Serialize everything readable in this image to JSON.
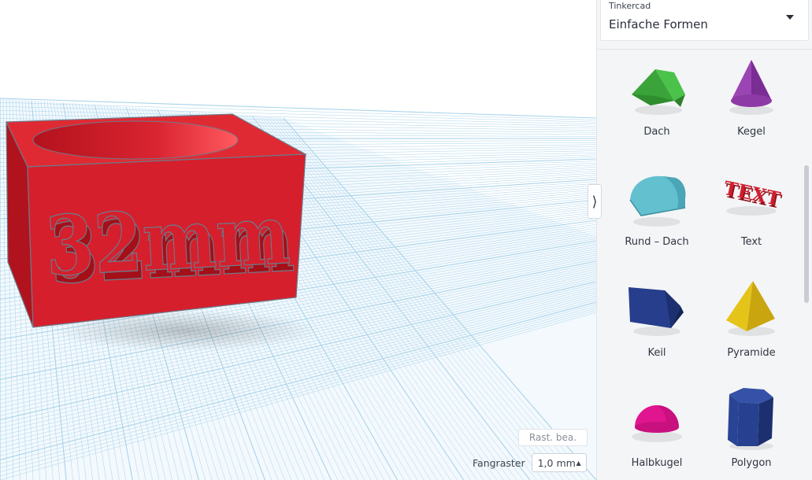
{
  "viewport": {
    "model_text": "32mm",
    "snap_label": "Fangraster",
    "snap_value": "1,0 mm",
    "edit_grid_label": "Rast. bea."
  },
  "shapes_panel": {
    "category_caption": "Tinkercad",
    "category_value": "Einfache Formen",
    "shapes": [
      {
        "label": "Dach",
        "icon": "roof-icon",
        "color": "#3aa339"
      },
      {
        "label": "Kegel",
        "icon": "cone-icon",
        "color": "#8e3aa6"
      },
      {
        "label": "Rund – Dach",
        "icon": "round-roof-icon",
        "color": "#62c0cf"
      },
      {
        "label": "Text",
        "icon": "text-3d-icon",
        "color": "#d01f2f"
      },
      {
        "label": "Keil",
        "icon": "wedge-icon",
        "color": "#263e8c"
      },
      {
        "label": "Pyramide",
        "icon": "pyramid-icon",
        "color": "#e5c41a"
      },
      {
        "label": "Halbkugel",
        "icon": "half-sphere-icon",
        "color": "#e0158f"
      },
      {
        "label": "Polygon",
        "icon": "polygon-icon",
        "color": "#27408f"
      }
    ]
  },
  "colors": {
    "model_red": "#d51f2c",
    "grid_line": "#a9d3ea",
    "panel_bg": "#f4f5f7"
  }
}
